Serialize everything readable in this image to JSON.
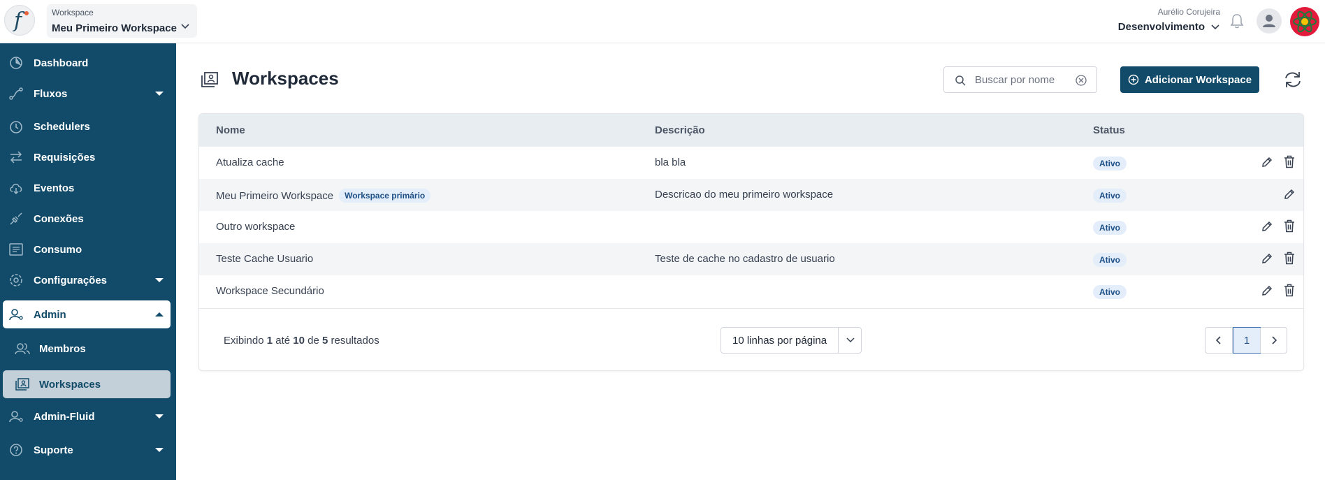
{
  "header": {
    "workspace_caption": "Workspace",
    "workspace_value": "Meu Primeiro Workspace",
    "user_name": "Aurélio Corujeira",
    "environment": "Desenvolvimento"
  },
  "sidebar": {
    "items": [
      {
        "label": "Dashboard",
        "icon": "dashboard-icon"
      },
      {
        "label": "Fluxos",
        "icon": "flow-icon"
      },
      {
        "label": "Schedulers",
        "icon": "clock-icon"
      },
      {
        "label": "Requisições",
        "icon": "arrows-swap-icon"
      },
      {
        "label": "Eventos",
        "icon": "cloud-download-icon"
      },
      {
        "label": "Conexões",
        "icon": "plug-icon"
      },
      {
        "label": "Consumo",
        "icon": "list-icon"
      },
      {
        "label": "Configurações",
        "icon": "gear-icon"
      },
      {
        "label": "Admin",
        "icon": "user-gear-icon"
      },
      {
        "label": "Membros",
        "icon": "users-icon"
      },
      {
        "label": "Workspaces",
        "icon": "workspace-icon"
      },
      {
        "label": "Admin-Fluid",
        "icon": "user-gear-icon"
      },
      {
        "label": "Suporte",
        "icon": "help-icon"
      }
    ]
  },
  "main": {
    "title": "Workspaces",
    "search_placeholder": "Buscar por nome",
    "add_label": "Adicionar Workspace",
    "columns": [
      "Nome",
      "Descrição",
      "Status"
    ],
    "rows": [
      {
        "name": "Atualiza cache",
        "badge": "",
        "description": "bla bla",
        "status": "Ativo"
      },
      {
        "name": "Meu Primeiro Workspace",
        "badge": "Workspace primário",
        "description": "Descricao do meu primeiro workspace",
        "status": "Ativo"
      },
      {
        "name": "Outro workspace",
        "badge": "",
        "description": "",
        "status": "Ativo"
      },
      {
        "name": "Teste Cache Usuario",
        "badge": "",
        "description": "Teste de cache no cadastro de usuario",
        "status": "Ativo"
      },
      {
        "name": "Workspace Secundário",
        "badge": "",
        "description": "",
        "status": "Ativo"
      }
    ],
    "footer": {
      "prefix": "Exibindo",
      "from": "1",
      "mid1": "até",
      "to": "10",
      "mid2": "de",
      "total": "5",
      "suffix": "resultados",
      "per_page": "10 linhas por página",
      "current_page": "1"
    }
  },
  "colors": {
    "sidebar_bg": "#114b69",
    "accent": "#114b69",
    "status_badge_bg": "#e3eefa",
    "status_badge_text": "#1e4f86"
  }
}
